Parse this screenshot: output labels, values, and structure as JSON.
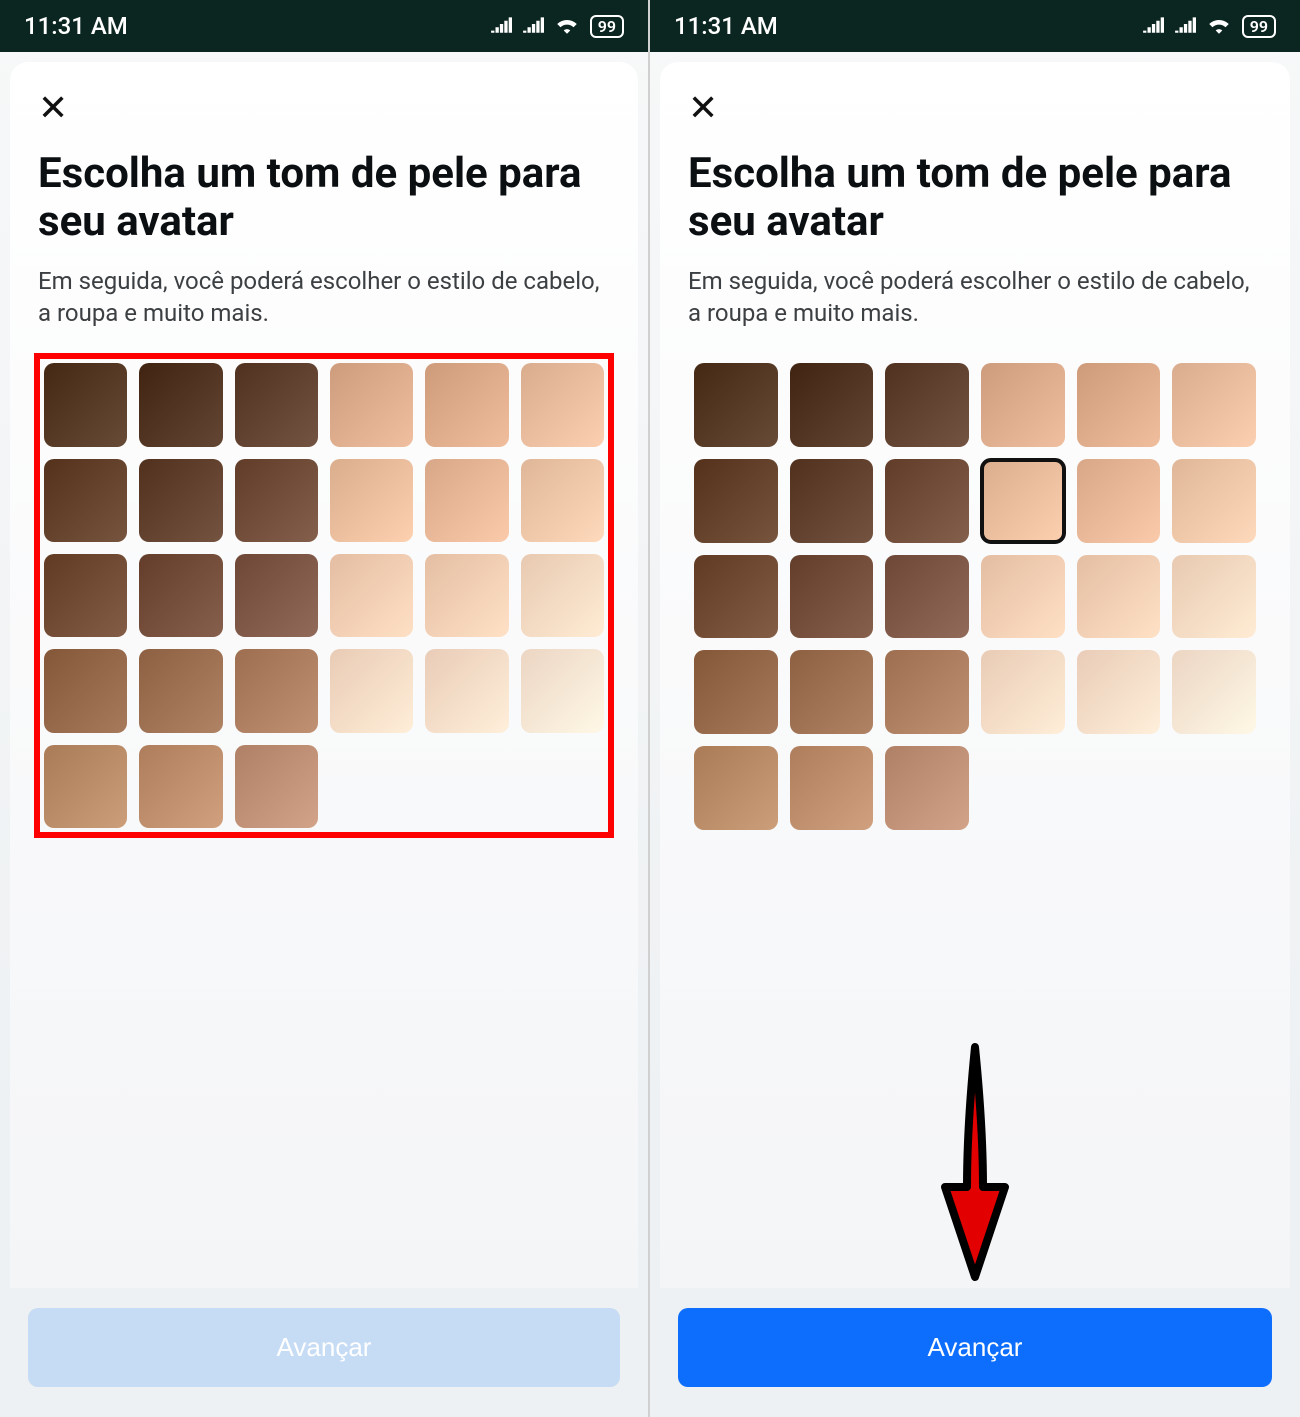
{
  "status": {
    "time": "11:31 AM",
    "battery": "99"
  },
  "screen": {
    "title": "Escolha um tom de pele para seu avatar",
    "subtitle": "Em seguida, você poderá escolher o estilo de cabelo, a roupa e muito mais.",
    "button_label": "Avançar"
  },
  "swatches": [
    "#4e321e",
    "#4a2e1b",
    "#5a3a28",
    "#d7a686",
    "#d8a584",
    "#e2b697",
    "#5d3b25",
    "#5b3a27",
    "#6a4633",
    "#e4b897",
    "#e1b191",
    "#e9c0a2",
    "#6b442d",
    "#6d4734",
    "#785141",
    "#eec7ac",
    "#eec8ad",
    "#f2d3bb",
    "#8f6143",
    "#976a4c",
    "#a7785a",
    "#f3d5bf",
    "#f3d6c1",
    "#f6dfcd",
    "#b38560",
    "#b88866",
    "#b98a70"
  ],
  "left": {
    "red_outline": true,
    "selected_index": null,
    "button_enabled": false
  },
  "right": {
    "red_outline": false,
    "selected_index": 9,
    "button_enabled": true,
    "show_arrow": true
  }
}
